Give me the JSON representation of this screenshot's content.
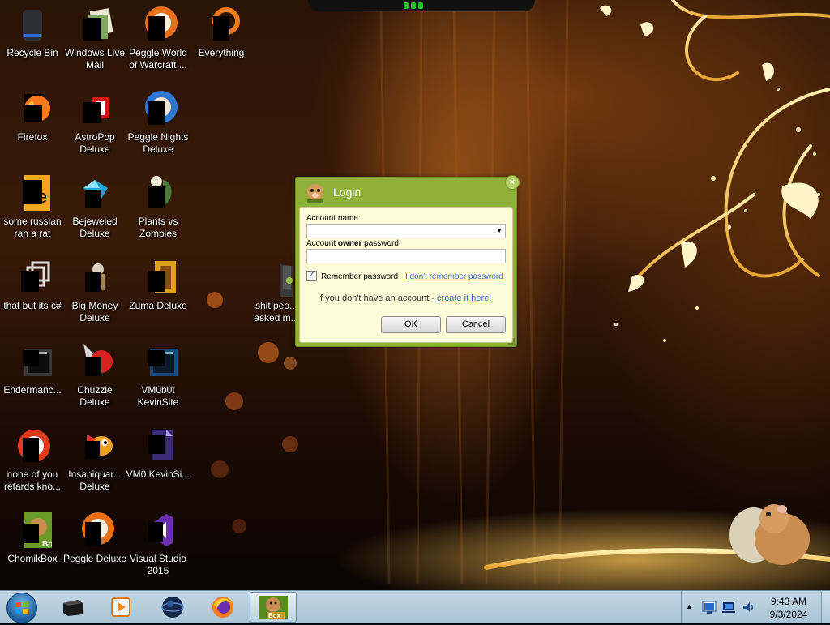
{
  "desktop": {
    "icons": [
      {
        "id": "recycle-bin",
        "label": "Recycle Bin",
        "icon": "recycle-bin-icon"
      },
      {
        "id": "windows-live-mail",
        "label": "Windows Live Mail",
        "icon": "mail-icon"
      },
      {
        "id": "peggle-world-of-warcraft",
        "label": "Peggle World of Warcraft ...",
        "icon": "peggle-icon"
      },
      {
        "id": "everything",
        "label": "Everything",
        "icon": "search-icon"
      },
      {
        "id": "firefox",
        "label": "Firefox",
        "icon": "firefox-icon"
      },
      {
        "id": "astropop-deluxe",
        "label": "AstroPop Deluxe",
        "icon": "astropop-icon"
      },
      {
        "id": "peggle-nights-deluxe",
        "label": "Peggle Nights Deluxe",
        "icon": "peggle-nights-icon"
      },
      {
        "id": "some-russian-ran-a-rat",
        "label": "some russian ran a rat",
        "icon": "java-file-icon"
      },
      {
        "id": "bejeweled-deluxe",
        "label": "Bejeweled Deluxe",
        "icon": "gem-icon"
      },
      {
        "id": "plants-vs-zombies",
        "label": "Plants vs Zombies",
        "icon": "plant-icon"
      },
      {
        "id": "that-but-its-csharp",
        "label": "that but its c#",
        "icon": "shortcut-window-icon"
      },
      {
        "id": "big-money-deluxe",
        "label": "Big Money Deluxe",
        "icon": "big-money-icon"
      },
      {
        "id": "zuma-deluxe",
        "label": "Zuma Deluxe",
        "icon": "zuma-icon"
      },
      {
        "id": "shit-people-asked",
        "label": "shit peo... asked m...",
        "icon": "folder-icon"
      },
      {
        "id": "endermanch",
        "label": "Endermanc...",
        "icon": "window-app-icon"
      },
      {
        "id": "chuzzle-deluxe",
        "label": "Chuzzle Deluxe",
        "icon": "chuzzle-icon"
      },
      {
        "id": "vm0b0t-kevinsite",
        "label": "VM0b0t KevinSite",
        "icon": "vm-window-icon"
      },
      {
        "id": "none-of-you",
        "label": "none of you retards kno...",
        "icon": "peggle-ball-icon"
      },
      {
        "id": "insaniquarium-deluxe",
        "label": "Insaniquar... Deluxe",
        "icon": "fish-icon"
      },
      {
        "id": "vm0-kevinsite",
        "label": "VM0 KevinSi...",
        "icon": "vs-file-icon"
      },
      {
        "id": "chomikbox",
        "label": "ChomikBox",
        "icon": "chomikbox-icon"
      },
      {
        "id": "peggle-deluxe",
        "label": "Peggle Deluxe",
        "icon": "peggle-deluxe-icon"
      },
      {
        "id": "visual-studio-2015",
        "label": "Visual Studio 2015",
        "icon": "visual-studio-icon"
      }
    ]
  },
  "dialog": {
    "title": "Login",
    "close_symbol": "×",
    "account_name_label": "Account name:",
    "account_name_value": "",
    "password_label_prefix": "Account ",
    "password_label_bold": "owner",
    "password_label_suffix": " password:",
    "password_value": "",
    "remember_label": "Remember password",
    "remember_checked": true,
    "check_mark": "✓",
    "forgot_link": "I don't remember password",
    "no_account_text": "If you don't have an account - ",
    "create_link": "create it here!",
    "ok_label": "OK",
    "cancel_label": "Cancel"
  },
  "taskbar": {
    "items": [
      {
        "id": "taskbar-item-terminal",
        "icon": "terminal-icon"
      },
      {
        "id": "taskbar-item-media-player",
        "icon": "media-player-icon"
      },
      {
        "id": "taskbar-item-sphere",
        "icon": "sphere-icon"
      },
      {
        "id": "taskbar-item-firefox",
        "icon": "firefox-icon"
      },
      {
        "id": "taskbar-item-chomikbox",
        "icon": "chomikbox-icon",
        "active": true
      }
    ],
    "tray_expand": "▲",
    "clock_time": "9:43 AM",
    "clock_date": "9/3/2024"
  },
  "colors": {
    "dialog_green": "#8fb13a",
    "dialog_panel": "#fdfbd8",
    "link_blue": "#3a6fb0",
    "taskbar": "#a9c3d6"
  }
}
